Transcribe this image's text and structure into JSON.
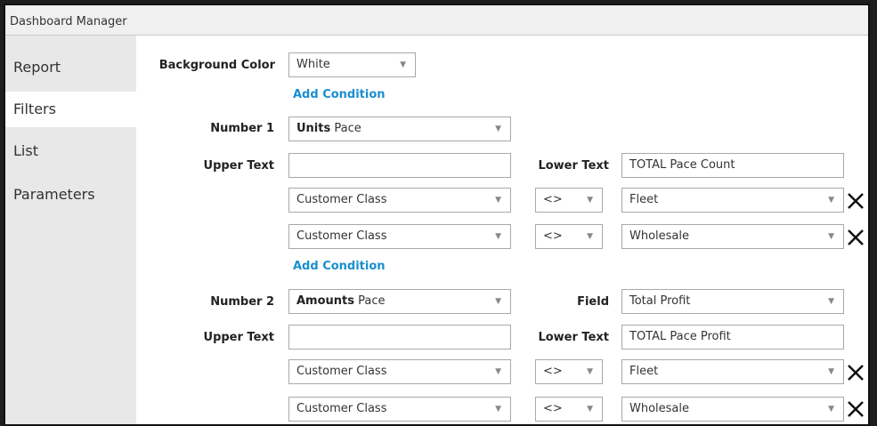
{
  "window": {
    "title": "Dashboard Manager"
  },
  "sidebar": {
    "items": [
      {
        "label": "Report"
      },
      {
        "label": "Filters"
      },
      {
        "label": "List"
      },
      {
        "label": "Parameters"
      }
    ]
  },
  "background": {
    "label": "Background Color",
    "value": "White"
  },
  "add_condition_label": "Add Condition",
  "number1": {
    "label": "Number 1",
    "metric_bold": "Units",
    "metric_rest": "Pace",
    "upper_text_label": "Upper Text",
    "upper_text_value": "",
    "lower_text_label": "Lower Text",
    "lower_text_value": "TOTAL Pace Count",
    "conditions": [
      {
        "field": "Customer Class",
        "operator": "<>",
        "value": "Fleet"
      },
      {
        "field": "Customer Class",
        "operator": "<>",
        "value": "Wholesale"
      }
    ]
  },
  "number2": {
    "label": "Number 2",
    "metric_bold": "Amounts",
    "metric_rest": "Pace",
    "field_label": "Field",
    "field_value": "Total Profit",
    "upper_text_label": "Upper Text",
    "upper_text_value": "",
    "lower_text_label": "Lower Text",
    "lower_text_value": "TOTAL Pace Profit",
    "conditions": [
      {
        "field": "Customer Class",
        "operator": "<>",
        "value": "Fleet"
      },
      {
        "field": "Customer Class",
        "operator": "<>",
        "value": "Wholesale"
      }
    ]
  },
  "icons": {
    "dropdown": "chevron-down-icon",
    "remove": "close-icon"
  }
}
